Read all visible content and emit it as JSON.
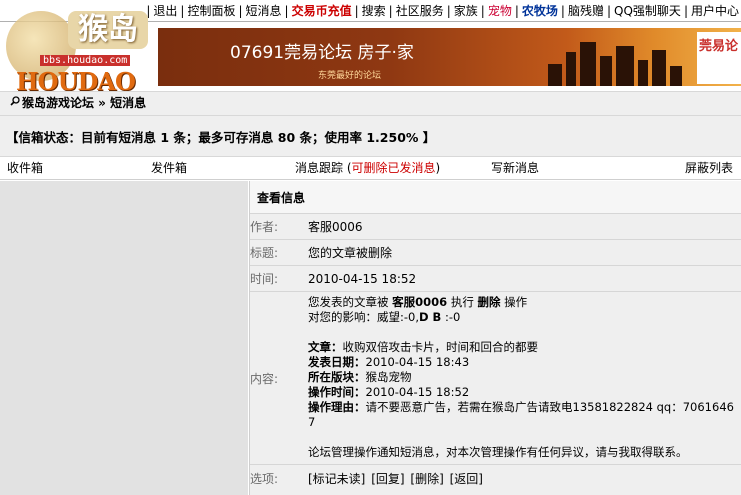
{
  "topnav": {
    "items": [
      {
        "label": "退出",
        "style": "normal"
      },
      {
        "label": "控制面板",
        "style": "normal"
      },
      {
        "label": "短消息",
        "style": "normal"
      },
      {
        "label": "交易币充值",
        "style": "red"
      },
      {
        "label": "搜索",
        "style": "normal"
      },
      {
        "label": "社区服务",
        "style": "normal"
      },
      {
        "label": "家族",
        "style": "normal"
      },
      {
        "label": "宠物",
        "style": "pink"
      },
      {
        "label": "农牧场",
        "style": "blue"
      },
      {
        "label": "脑残赠",
        "style": "normal"
      },
      {
        "label": "QQ强制聊天",
        "style": "normal"
      },
      {
        "label": "用户中心",
        "style": "normal"
      }
    ]
  },
  "logo": {
    "chinese": "猴岛",
    "url": "bbs.houdao.com",
    "brand": "HOUDAO"
  },
  "banner": {
    "title": "07691莞易论坛 房子·家",
    "subtitle": "东莞最好的论坛",
    "brand": "莞易论"
  },
  "breadcrumb": "猴岛游戏论坛 » 短消息",
  "status": "【信箱状态：目前有短消息 1 条；最多可存消息 80 条；使用率 1.250% 】",
  "tabs": {
    "inbox": "收件箱",
    "outbox": "发件箱",
    "track_prefix": "消息跟踪 (",
    "track_link": "可删除已发消息",
    "track_suffix": ")",
    "compose": "写新消息",
    "blocklist": "屏蔽列表"
  },
  "message": {
    "panel_title": "查看信息",
    "author_label": "作者:",
    "author": "客服0006",
    "subject_label": "标题:",
    "subject": "您的文章被删除",
    "time_label": "时间:",
    "time": "2010-04-15 18:52",
    "content_label": "内容:",
    "content": {
      "line1_a": "您发表的文章被 ",
      "line1_b": "客服0006",
      "line1_c": " 执行 ",
      "line1_d": "删除",
      "line1_e": " 操作",
      "line2_a": "对您的影响：威望:-0,",
      "line2_b": "D B",
      "line2_c": " :-0",
      "article_label": "文章：",
      "article": "收购双倍攻击卡片，时间和回合的都要",
      "posted_label": "发表日期：",
      "posted": "2010-04-15 18:43",
      "board_label": "所在版块：",
      "board": "猴岛宠物",
      "optime_label": "操作时间：",
      "optime": "2010-04-15 18:52",
      "reason_label": "操作理由：",
      "reason": "请不要恶意广告，若需在猴岛广告请致电13581822824 qq：70616467",
      "footer": "论坛管理操作通知短消息，对本次管理操作有任何异议，请与我取得联系。"
    },
    "options_label": "选项:",
    "options": [
      "[标记未读]",
      "[回复]",
      "[删除]",
      "[返回]"
    ]
  },
  "colors": {
    "accent_red": "#cc0000",
    "nav_blue": "#003399",
    "panel_gray": "#efefef",
    "left_gray": "#e2e2e2"
  }
}
